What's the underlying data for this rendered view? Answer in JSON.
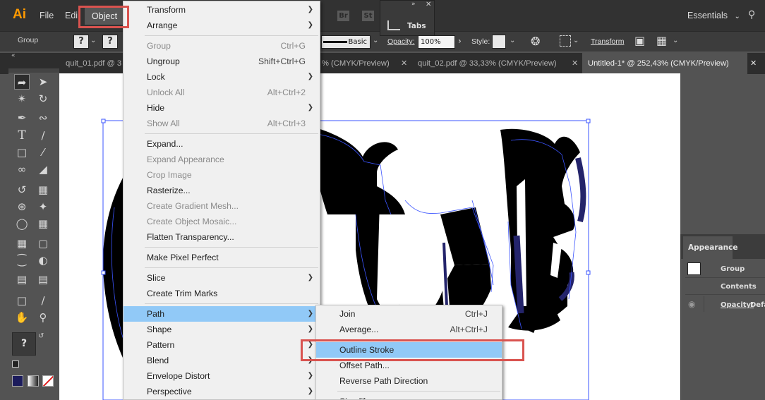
{
  "app": {
    "logo": "Ai",
    "menus": [
      "File",
      "Edit",
      "Object"
    ],
    "workspace": "Essentials"
  },
  "bridge": {
    "br": "Br",
    "st": "St"
  },
  "tabs_panel": {
    "label": "Tabs"
  },
  "control": {
    "selection": "Group",
    "stroke_profile": "Basic",
    "opacity_label": "Opacity:",
    "opacity_value": "100%",
    "style_label": "Style:",
    "transform_label": "Transform"
  },
  "doc_tabs": [
    {
      "title": "quit_01.pdf @ 3"
    },
    {
      "title": "% (CMYK/Preview)"
    },
    {
      "title": "quit_02.pdf @ 33,33% (CMYK/Preview)"
    },
    {
      "title": "Untitled-1* @ 252,43% (CMYK/Preview)"
    }
  ],
  "object_menu": {
    "items": [
      {
        "label": "Transform",
        "shortcut": "",
        "submenu": true,
        "disabled": false
      },
      {
        "label": "Arrange",
        "shortcut": "",
        "submenu": true,
        "disabled": false
      },
      {
        "sep": true
      },
      {
        "label": "Group",
        "shortcut": "Ctrl+G",
        "submenu": false,
        "disabled": true
      },
      {
        "label": "Ungroup",
        "shortcut": "Shift+Ctrl+G",
        "submenu": false,
        "disabled": false
      },
      {
        "label": "Lock",
        "shortcut": "",
        "submenu": true,
        "disabled": false
      },
      {
        "label": "Unlock All",
        "shortcut": "Alt+Ctrl+2",
        "submenu": false,
        "disabled": true
      },
      {
        "label": "Hide",
        "shortcut": "",
        "submenu": true,
        "disabled": false
      },
      {
        "label": "Show All",
        "shortcut": "Alt+Ctrl+3",
        "submenu": false,
        "disabled": true
      },
      {
        "sep": true
      },
      {
        "label": "Expand...",
        "shortcut": "",
        "submenu": false,
        "disabled": false
      },
      {
        "label": "Expand Appearance",
        "shortcut": "",
        "submenu": false,
        "disabled": true
      },
      {
        "label": "Crop Image",
        "shortcut": "",
        "submenu": false,
        "disabled": true
      },
      {
        "label": "Rasterize...",
        "shortcut": "",
        "submenu": false,
        "disabled": false
      },
      {
        "label": "Create Gradient Mesh...",
        "shortcut": "",
        "submenu": false,
        "disabled": true
      },
      {
        "label": "Create Object Mosaic...",
        "shortcut": "",
        "submenu": false,
        "disabled": true
      },
      {
        "label": "Flatten Transparency...",
        "shortcut": "",
        "submenu": false,
        "disabled": false
      },
      {
        "sep": true
      },
      {
        "label": "Make Pixel Perfect",
        "shortcut": "",
        "submenu": false,
        "disabled": false
      },
      {
        "sep": true
      },
      {
        "label": "Slice",
        "shortcut": "",
        "submenu": true,
        "disabled": false
      },
      {
        "label": "Create Trim Marks",
        "shortcut": "",
        "submenu": false,
        "disabled": false
      },
      {
        "sep": true
      },
      {
        "label": "Path",
        "shortcut": "",
        "submenu": true,
        "disabled": false,
        "highlighted": true
      },
      {
        "label": "Shape",
        "shortcut": "",
        "submenu": true,
        "disabled": false
      },
      {
        "label": "Pattern",
        "shortcut": "",
        "submenu": true,
        "disabled": false
      },
      {
        "label": "Blend",
        "shortcut": "",
        "submenu": true,
        "disabled": false
      },
      {
        "label": "Envelope Distort",
        "shortcut": "",
        "submenu": true,
        "disabled": false
      },
      {
        "label": "Perspective",
        "shortcut": "",
        "submenu": true,
        "disabled": false
      }
    ]
  },
  "path_submenu": {
    "items": [
      {
        "label": "Join",
        "shortcut": "Ctrl+J"
      },
      {
        "label": "Average...",
        "shortcut": "Alt+Ctrl+J"
      },
      {
        "sep": true
      },
      {
        "label": "Outline Stroke",
        "shortcut": "",
        "highlighted": true
      },
      {
        "label": "Offset Path...",
        "shortcut": ""
      },
      {
        "label": "Reverse Path Direction",
        "shortcut": ""
      },
      {
        "sep": true
      },
      {
        "label": "Simplify...",
        "shortcut": ""
      }
    ]
  },
  "appearance_panel": {
    "title": "Appearance",
    "group_label": "Group",
    "contents_label": "Contents",
    "opacity_label": "Opacity:",
    "opacity_value": "Defa"
  },
  "colors": {
    "highlight": "#91c9f7",
    "callout": "#d9534f",
    "logo": "#ff9a00",
    "fill_swatch": "#1c1c5c"
  }
}
